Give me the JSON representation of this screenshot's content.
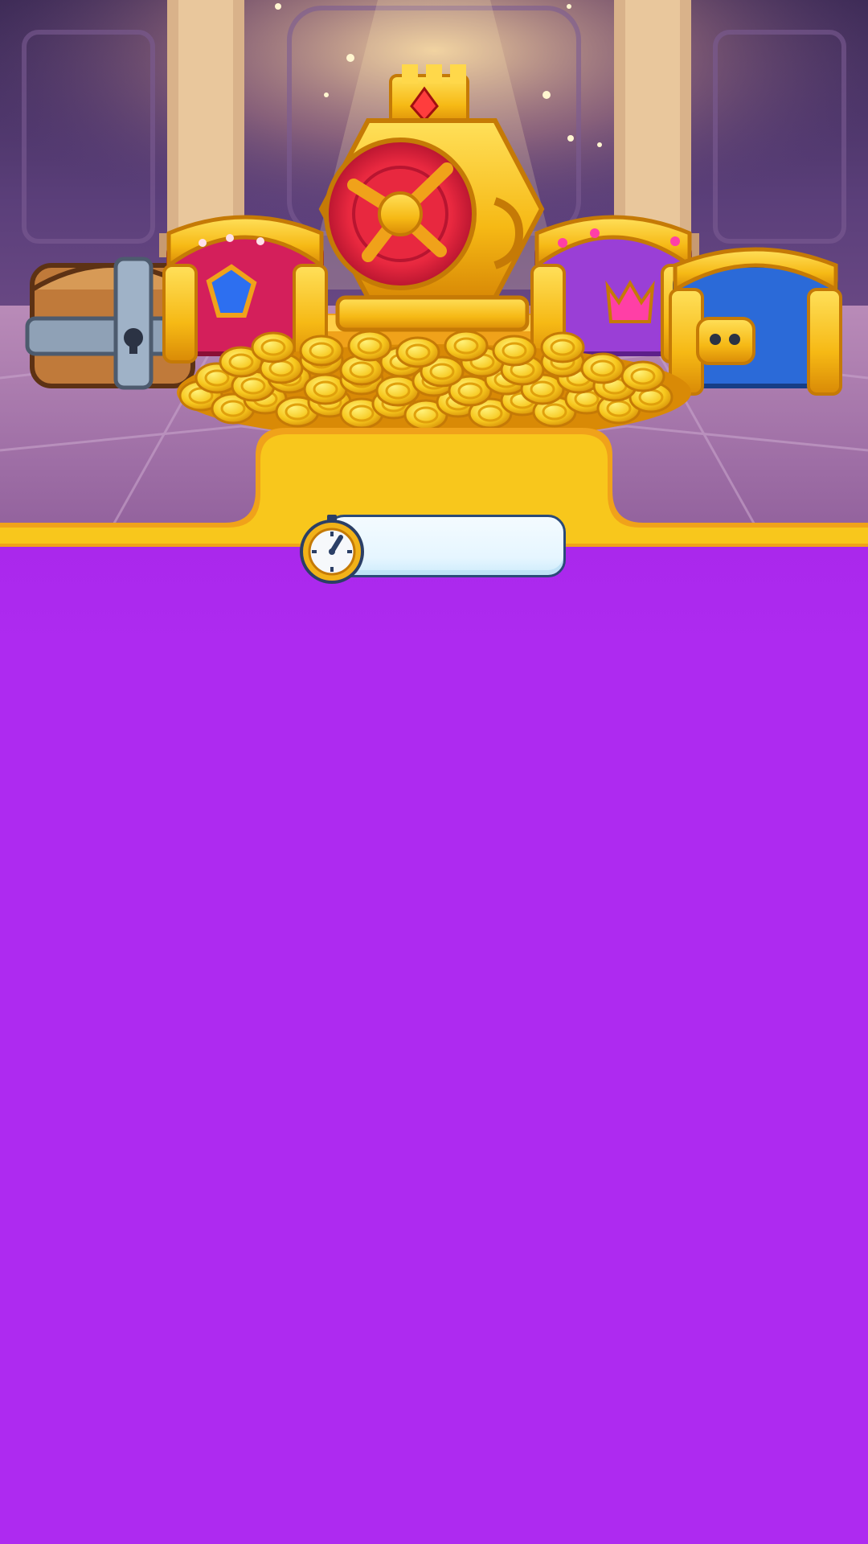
{
  "scene": {
    "name": "treasure-vault",
    "panel_color": "#ae2af0",
    "gold_color": "#f6c21c"
  },
  "timer": {
    "icon": "stopwatch-icon",
    "value": ""
  },
  "icons": {
    "vault": "vault-safe-icon",
    "chests": [
      "wooden-chest-icon",
      "ruby-chest-icon",
      "purple-chest-icon",
      "blue-chest-icon"
    ],
    "coins": "coin-pile-icon"
  }
}
